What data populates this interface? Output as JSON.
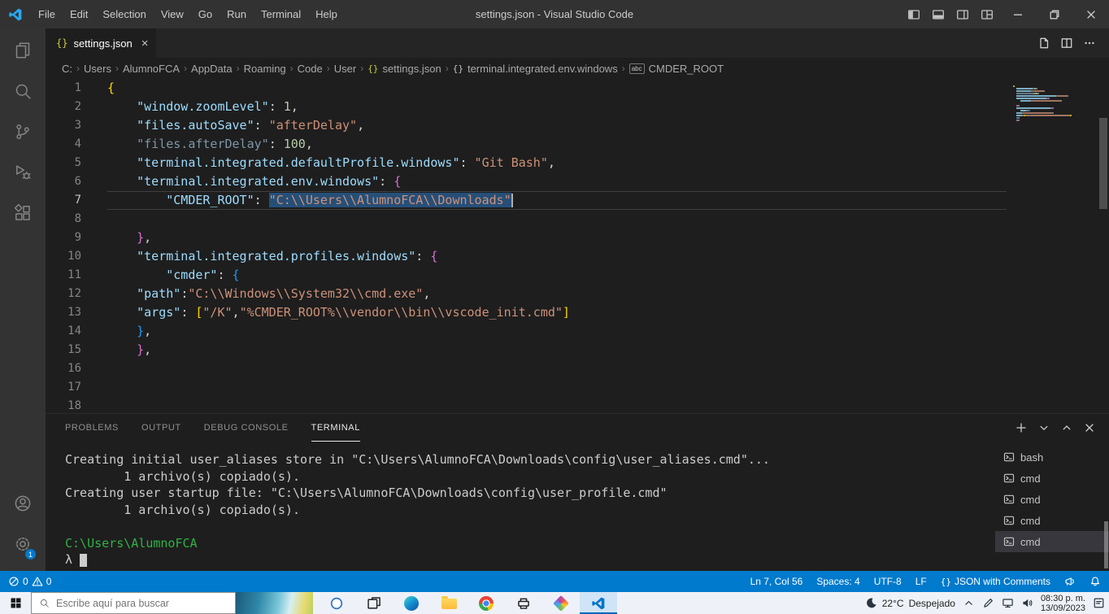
{
  "colors": {
    "accent": "#007acc",
    "editor_background": "#1e1e1e",
    "selection": "#264f78",
    "terminal_green": "#2fb344",
    "tokens": {
      "key": "#9cdcfe",
      "key_dim": "#7e96a8",
      "string": "#ce9178",
      "number": "#b5cea8",
      "punctuation": "#d4d4d4",
      "bracket1": "#ffd700",
      "bracket2": "#da70d6",
      "bracket3": "#179fff"
    }
  },
  "title_bar": {
    "app_icon": "vscode-logo-icon",
    "menus": [
      "File",
      "Edit",
      "Selection",
      "View",
      "Go",
      "Run",
      "Terminal",
      "Help"
    ],
    "title": "settings.json - Visual Studio Code",
    "layout_icons": [
      "toggle-sidebar-icon",
      "toggle-panel-icon",
      "toggle-secondary-sidebar-icon",
      "customize-layout-icon"
    ],
    "window_icons": [
      "minimize-icon",
      "restore-icon",
      "close-icon"
    ]
  },
  "activity_bar": {
    "top_icons": [
      "explorer-icon",
      "search-icon",
      "source-control-icon",
      "run-debug-icon",
      "extensions-icon"
    ],
    "bottom_icons": [
      "account-icon",
      "settings-gear-icon"
    ],
    "settings_badge": "1"
  },
  "tab_bar": {
    "tab": {
      "icon": "json-braces-icon",
      "icon_text": "{}",
      "label": "settings.json",
      "close": "×"
    },
    "action_icons": [
      "open-settings-ui-icon",
      "split-editor-icon",
      "more-actions-icon"
    ]
  },
  "breadcrumb": {
    "items": [
      {
        "label": "C:"
      },
      {
        "label": "Users"
      },
      {
        "label": "AlumnoFCA"
      },
      {
        "label": "AppData"
      },
      {
        "label": "Roaming"
      },
      {
        "label": "Code"
      },
      {
        "label": "User"
      },
      {
        "icon": "braces",
        "icon_text": "{}",
        "icon_color": "#cbcb41",
        "label": "settings.json"
      },
      {
        "icon": "braces",
        "icon_text": "{}",
        "icon_color": "#c5c5c5",
        "label": "terminal.integrated.env.windows"
      },
      {
        "icon": "abc",
        "icon_text": "abc",
        "icon_color": "#c5c5c5",
        "label": "CMDER_ROOT"
      }
    ]
  },
  "editor": {
    "current_line": 7,
    "lines": [
      {
        "n": 1,
        "tokens": [
          {
            "t": "{",
            "c": "b1"
          }
        ]
      },
      {
        "n": 2,
        "tokens": [
          {
            "t": "    ",
            "c": "pun"
          },
          {
            "t": "\"window.zoomLevel\"",
            "c": "key"
          },
          {
            "t": ": ",
            "c": "pun"
          },
          {
            "t": "1",
            "c": "num"
          },
          {
            "t": ",",
            "c": "pun"
          }
        ]
      },
      {
        "n": 3,
        "tokens": [
          {
            "t": "    ",
            "c": "pun"
          },
          {
            "t": "\"files.autoSave\"",
            "c": "key"
          },
          {
            "t": ": ",
            "c": "pun"
          },
          {
            "t": "\"afterDelay\"",
            "c": "str"
          },
          {
            "t": ",",
            "c": "pun"
          }
        ]
      },
      {
        "n": 4,
        "tokens": [
          {
            "t": "    ",
            "c": "pun"
          },
          {
            "t": "\"files.afterDelay\"",
            "c": "keydim"
          },
          {
            "t": ": ",
            "c": "pun"
          },
          {
            "t": "100",
            "c": "num"
          },
          {
            "t": ",",
            "c": "pun"
          }
        ]
      },
      {
        "n": 5,
        "tokens": [
          {
            "t": "    ",
            "c": "pun"
          },
          {
            "t": "\"terminal.integrated.defaultProfile.windows\"",
            "c": "key"
          },
          {
            "t": ": ",
            "c": "pun"
          },
          {
            "t": "\"Git Bash\"",
            "c": "str"
          },
          {
            "t": ",",
            "c": "pun"
          }
        ]
      },
      {
        "n": 6,
        "tokens": [
          {
            "t": "    ",
            "c": "pun"
          },
          {
            "t": "\"terminal.integrated.env.windows\"",
            "c": "key"
          },
          {
            "t": ": ",
            "c": "pun"
          },
          {
            "t": "{",
            "c": "b2"
          }
        ]
      },
      {
        "n": 7,
        "tokens": [
          {
            "t": "        ",
            "c": "pun"
          },
          {
            "t": "\"CMDER_ROOT\"",
            "c": "key"
          },
          {
            "t": ": ",
            "c": "pun"
          },
          {
            "t": "\"C:\\\\Users\\\\AlumnoFCA\\\\Downloads\"",
            "c": "str",
            "sel": true
          }
        ]
      },
      {
        "n": 8,
        "tokens": []
      },
      {
        "n": 9,
        "tokens": [
          {
            "t": "    ",
            "c": "pun"
          },
          {
            "t": "}",
            "c": "b2"
          },
          {
            "t": ",",
            "c": "pun"
          }
        ]
      },
      {
        "n": 10,
        "tokens": [
          {
            "t": "    ",
            "c": "pun"
          },
          {
            "t": "\"terminal.integrated.profiles.windows\"",
            "c": "key"
          },
          {
            "t": ": ",
            "c": "pun"
          },
          {
            "t": "{",
            "c": "b2"
          }
        ]
      },
      {
        "n": 11,
        "tokens": [
          {
            "t": "        ",
            "c": "pun"
          },
          {
            "t": "\"cmder\"",
            "c": "key"
          },
          {
            "t": ": ",
            "c": "pun"
          },
          {
            "t": "{",
            "c": "b3"
          }
        ]
      },
      {
        "n": 12,
        "tokens": [
          {
            "t": "    ",
            "c": "pun"
          },
          {
            "t": "\"path\"",
            "c": "key"
          },
          {
            "t": ":",
            "c": "pun"
          },
          {
            "t": "\"C:\\\\Windows\\\\System32\\\\cmd.exe\"",
            "c": "str"
          },
          {
            "t": ",",
            "c": "pun"
          }
        ]
      },
      {
        "n": 13,
        "tokens": [
          {
            "t": "    ",
            "c": "pun"
          },
          {
            "t": "\"args\"",
            "c": "key"
          },
          {
            "t": ": ",
            "c": "pun"
          },
          {
            "t": "[",
            "c": "b1"
          },
          {
            "t": "\"/K\"",
            "c": "str"
          },
          {
            "t": ",",
            "c": "pun"
          },
          {
            "t": "\"%CMDER_ROOT%\\\\vendor\\\\bin\\\\vscode_init.cmd\"",
            "c": "str"
          },
          {
            "t": "]",
            "c": "b1"
          }
        ]
      },
      {
        "n": 14,
        "tokens": [
          {
            "t": "    ",
            "c": "pun"
          },
          {
            "t": "}",
            "c": "b3"
          },
          {
            "t": ",",
            "c": "pun"
          }
        ]
      },
      {
        "n": 15,
        "tokens": [
          {
            "t": "    ",
            "c": "pun"
          },
          {
            "t": "}",
            "c": "b2"
          },
          {
            "t": ",",
            "c": "pun"
          }
        ]
      },
      {
        "n": 16,
        "tokens": []
      },
      {
        "n": 17,
        "tokens": []
      },
      {
        "n": 18,
        "tokens": []
      }
    ]
  },
  "panel": {
    "tabs": [
      "PROBLEMS",
      "OUTPUT",
      "DEBUG CONSOLE",
      "TERMINAL"
    ],
    "active_tab": "TERMINAL",
    "action_icons": [
      "plus-icon",
      "chevron-down-icon",
      "chevron-up-icon",
      "close-icon"
    ]
  },
  "terminal": {
    "lines": [
      {
        "text": "Creating initial user_aliases store in \"C:\\Users\\AlumnoFCA\\Downloads\\config\\user_aliases.cmd\"...",
        "color": "default"
      },
      {
        "text": "        1 archivo(s) copi​ado(s).",
        "color": "default"
      },
      {
        "text": "Creating user startup file: \"C:\\Users\\AlumnoFCA\\Downloads\\config\\user_profile.cmd\"",
        "color": "default"
      },
      {
        "text": "        1 archivo(s) copiado(s).",
        "color": "default"
      },
      {
        "text": "",
        "color": "default"
      },
      {
        "text": "C:\\Users\\AlumnoFCA",
        "color": "green"
      },
      {
        "text": "λ ",
        "color": "default",
        "cursor": true
      }
    ],
    "tabs_list": [
      {
        "label": "bash"
      },
      {
        "label": "cmd"
      },
      {
        "label": "cmd"
      },
      {
        "label": "cmd"
      },
      {
        "label": "cmd",
        "active": true
      }
    ]
  },
  "status_bar": {
    "errors": "0",
    "warnings": "0",
    "cursor_position": "Ln 7, Col 56",
    "indentation": "Spaces: 4",
    "encoding": "UTF-8",
    "eol": "LF",
    "language": "JSON with Comments",
    "language_icon_text": "{}",
    "right_icons": [
      "feedback-icon",
      "bell-icon"
    ]
  },
  "taskbar": {
    "start_icon": "windows-start-icon",
    "search_placeholder": "Escribe aquí para buscar",
    "widget": "weather-widget-image",
    "app_icons": [
      "cortana-icon",
      "task-view-icon",
      "edge-icon",
      "file-explorer-icon",
      "chrome-icon",
      "devices-icon",
      "photos-icon",
      "vscode-icon"
    ],
    "active_app": "vscode-icon",
    "tray": {
      "moon_icon": "moon-icon",
      "temperature": "22°C",
      "condition": "Despejado",
      "overflow_icon": "chevron-up-icon",
      "tray_icons": [
        "pen-icon",
        "network-icon",
        "volume-icon"
      ],
      "time": "08:30 p. m.",
      "date": "13/09/2023",
      "action_center_icon": "action-center-icon"
    }
  }
}
